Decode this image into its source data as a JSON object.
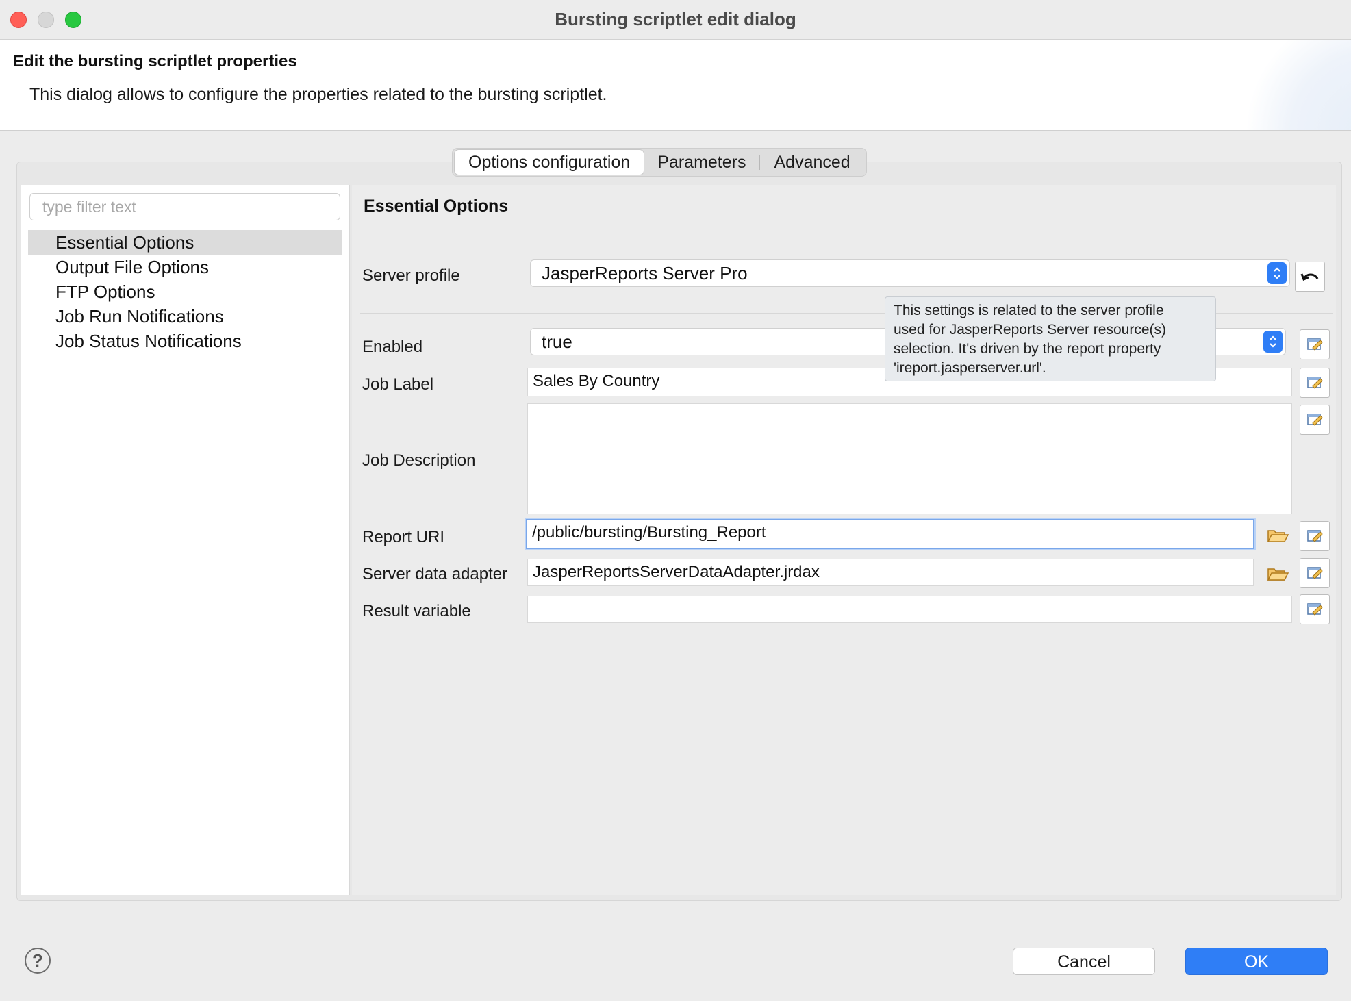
{
  "window": {
    "title": "Bursting scriptlet edit dialog"
  },
  "header": {
    "title": "Edit the bursting scriptlet properties",
    "description": "This dialog allows to configure the properties related to the bursting scriptlet."
  },
  "tabs": [
    {
      "label": "Options configuration",
      "active": true
    },
    {
      "label": "Parameters",
      "active": false
    },
    {
      "label": "Advanced",
      "active": false
    }
  ],
  "sidebar": {
    "filter_placeholder": "type filter text",
    "items": [
      {
        "label": "Essential Options",
        "selected": true
      },
      {
        "label": "Output File Options",
        "selected": false
      },
      {
        "label": "FTP Options",
        "selected": false
      },
      {
        "label": "Job Run Notifications",
        "selected": false
      },
      {
        "label": "Job Status Notifications",
        "selected": false
      }
    ]
  },
  "section": {
    "title": "Essential Options"
  },
  "form": {
    "server_profile": {
      "label": "Server profile",
      "value": "JasperReports Server Pro"
    },
    "enabled": {
      "label": "Enabled",
      "value": "true"
    },
    "job_label": {
      "label": "Job Label",
      "value": "Sales By Country"
    },
    "job_description": {
      "label": "Job Description",
      "value": ""
    },
    "report_uri": {
      "label": "Report URI",
      "value": "/public/bursting/Bursting_Report"
    },
    "server_data_adapter": {
      "label": "Server data adapter",
      "value": "JasperReportsServerDataAdapter.jrdax"
    },
    "result_variable": {
      "label": "Result variable",
      "value": ""
    }
  },
  "tooltip": {
    "lines": [
      "This settings is related to the server profile",
      "used for JasperReports Server resource(s)",
      "selection. It's driven by the report property",
      "'ireport.jasperserver.url'."
    ]
  },
  "footer": {
    "help_label": "?",
    "cancel_label": "Cancel",
    "ok_label": "OK"
  },
  "colors": {
    "accent": "#2f7ef6",
    "focus_ring": "#7aa7ea",
    "folder": "#e0a43a"
  },
  "icons": {
    "reset": "undo-arrow-icon",
    "edit": "edit-expression-icon",
    "browse": "folder-open-icon",
    "stepper": "up-down-chevron-icon",
    "help": "question-mark-icon"
  }
}
